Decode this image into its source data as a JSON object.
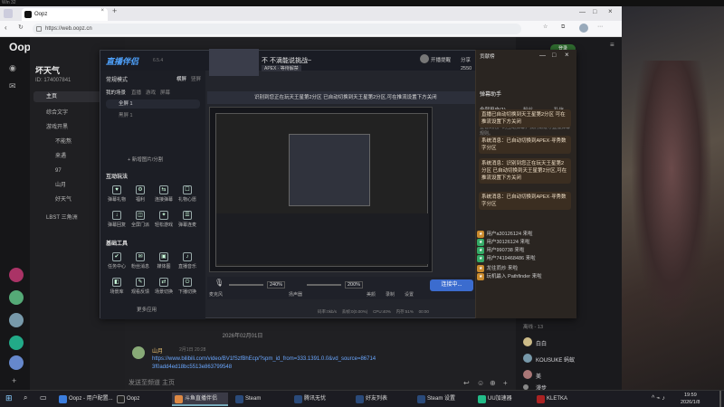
{
  "top_strip": "Win 32",
  "browser": {
    "tab_title": "Oopz",
    "url": "https://web.oopz.cn",
    "search_placeholder": "搜索你感兴趣的频道",
    "login_button": "登录"
  },
  "oopz": {
    "brand": "Oopz",
    "user_name": "坏天气",
    "user_id": "ID: 174007841",
    "channel_button": "创建频道",
    "nav": [
      {
        "label": "主页",
        "active": true
      },
      {
        "label": "综合文字"
      },
      {
        "label": "游戏开黑"
      },
      {
        "label": "不能熬"
      },
      {
        "label": "来遇"
      },
      {
        "label": "97"
      },
      {
        "label": "山月"
      },
      {
        "label": "好天气"
      },
      {
        "label": "LBST 三角洲"
      }
    ],
    "chat": {
      "date_divider": "2026年02月01日",
      "message_user": "山月",
      "message_time": "2月1日 20:28",
      "message_link": "https://www.bilibili.com/video/BV1fSzfBhEcp/?spm_id_from=333.1391.0.0&vd_source=867143f0add4ed18bc5513e863799548",
      "input_placeholder": "发送至频道 主页"
    },
    "members": {
      "online_header": "离线 - 13",
      "list": [
        "白白",
        "KOUSUKE 蚂蚁",
        "美",
        "漫步",
        "无风玄",
        "深林"
      ]
    }
  },
  "live_app": {
    "title": "直播伴侣",
    "version": "6.5.4",
    "mode_label": "常规模式",
    "tabs": [
      "横屏",
      "竖屏"
    ],
    "scene_tabs": [
      "我的场景",
      "直播",
      "游戏",
      "屏幕"
    ],
    "scenes": [
      "全屏 1",
      "黑屏 1"
    ],
    "add_scene": "+ 新增图片/分割",
    "stream_title": "不 不滴能说挑战~",
    "stream_tags": [
      "APEX · 等待解禁"
    ],
    "preview_banner": "识别到您正在玩天王星第2分区 已自动切换到天王星第2分区,可在推流设置下方关闭",
    "top_right_buttons": [
      "开播提醒",
      "分享"
    ],
    "viewer_count": "2550",
    "sections": {
      "interactive": "互动玩法",
      "basic_tools": "基础工具"
    },
    "interactive_tools": [
      "弹幕礼物",
      "福利",
      "连接弹幕",
      "礼物心愿",
      "弹幕回复",
      "全屏门派",
      "轻松游戏",
      "弹幕连麦"
    ],
    "basic_tools_list": [
      "任务中心",
      "粉丝消息",
      "媒体图",
      "直播音乐",
      "场景库",
      "观看反馈",
      "场景切换",
      "下播切换"
    ],
    "more_apps": "更多应用",
    "controls": {
      "mic_label": "麦克风",
      "mic_value": "240%",
      "speaker_label": "扬声器",
      "speaker_value": "200%",
      "effects": "美颜",
      "record": "录制",
      "settings": "设置",
      "start_button": "连接中..."
    },
    "stats": [
      "码率:0kb/s",
      "丢帧:0(0.00%)",
      "CPU:40%",
      "内存:51%",
      "00:00"
    ]
  },
  "assistant": {
    "title": "弹幕助手",
    "tabs": [
      "全部用户(1)",
      "粉丝",
      "私信"
    ],
    "intro": "在弹幕中来刷新弹幕，发出赞。在这里你可以查看到用户的互动弹幕，我们请遵守直播弹幕规则。",
    "messages": [
      "直播已自动切换到天王星第2分区 可在推流设置下方关闭",
      "系统消息：已自动切换到APEX·寻秀数字分区",
      "系统消息：识别到您正在玩天王星第2分区 已自动切换到天王星第2分区,可在推流设置下方关闭",
      "系统消息：已自动切换到APEX·寻秀数字分区"
    ],
    "chat": [
      {
        "name": "用户a30126124",
        "text": "来啦"
      },
      {
        "name": "用户30126124",
        "text": "来啦"
      },
      {
        "name": "用户990738",
        "text": "来啦"
      },
      {
        "name": "用户7419468486",
        "text": "来啦"
      },
      {
        "name": "龙往而炒",
        "text": "来啦"
      },
      {
        "name": "玩机最入",
        "text": "Pathfinder 来啦"
      }
    ]
  },
  "taskbar": {
    "items": [
      "Oopz - 用户配置...",
      "Oopz",
      "斗鱼直播伴侣",
      "Steam",
      "腾讯无忧",
      "好友列表",
      "Steam 设置",
      "UU加速器",
      "KLETKA"
    ],
    "time": "19:59",
    "date": "2026/1/8"
  },
  "colors": {
    "accent": "#c98a2d",
    "oopz_bg": "#1e1e21",
    "live_blue": "#3b6ccf"
  }
}
